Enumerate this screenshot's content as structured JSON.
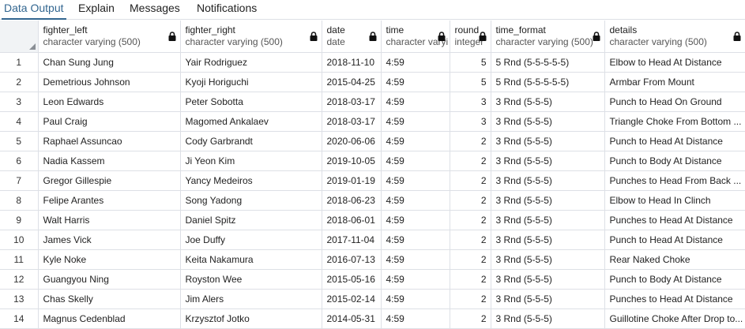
{
  "tabs": [
    {
      "label": "Data Output"
    },
    {
      "label": "Explain"
    },
    {
      "label": "Messages"
    },
    {
      "label": "Notifications"
    }
  ],
  "columns": [
    {
      "name": "fighter_left",
      "type": "character varying (500)"
    },
    {
      "name": "fighter_right",
      "type": "character varying (500)"
    },
    {
      "name": "date",
      "type": "date"
    },
    {
      "name": "time",
      "type": "character varyi"
    },
    {
      "name": "round",
      "type": "integer"
    },
    {
      "name": "time_format",
      "type": "character varying (500)"
    },
    {
      "name": "details",
      "type": "character varying (500)"
    }
  ],
  "rows": [
    [
      "1",
      "Chan Sung Jung",
      "Yair Rodriguez",
      "2018-11-10",
      "4:59",
      "5",
      "5 Rnd (5-5-5-5-5)",
      "Elbow to Head At Distance"
    ],
    [
      "2",
      "Demetrious Johnson",
      "Kyoji Horiguchi",
      "2015-04-25",
      "4:59",
      "5",
      "5 Rnd (5-5-5-5-5)",
      "Armbar From Mount"
    ],
    [
      "3",
      "Leon Edwards",
      "Peter Sobotta",
      "2018-03-17",
      "4:59",
      "3",
      "3 Rnd (5-5-5)",
      "Punch to Head On Ground"
    ],
    [
      "4",
      "Paul Craig",
      "Magomed Ankalaev",
      "2018-03-17",
      "4:59",
      "3",
      "3 Rnd (5-5-5)",
      "Triangle Choke From Bottom ..."
    ],
    [
      "5",
      "Raphael Assuncao",
      "Cody Garbrandt",
      "2020-06-06",
      "4:59",
      "2",
      "3 Rnd (5-5-5)",
      "Punch to Head At Distance"
    ],
    [
      "6",
      "Nadia Kassem",
      "Ji Yeon Kim",
      "2019-10-05",
      "4:59",
      "2",
      "3 Rnd (5-5-5)",
      "Punch to Body At Distance"
    ],
    [
      "7",
      "Gregor Gillespie",
      "Yancy Medeiros",
      "2019-01-19",
      "4:59",
      "2",
      "3 Rnd (5-5-5)",
      "Punches to Head From Back ..."
    ],
    [
      "8",
      "Felipe Arantes",
      "Song Yadong",
      "2018-06-23",
      "4:59",
      "2",
      "3 Rnd (5-5-5)",
      "Elbow to Head In Clinch"
    ],
    [
      "9",
      "Walt Harris",
      "Daniel Spitz",
      "2018-06-01",
      "4:59",
      "2",
      "3 Rnd (5-5-5)",
      "Punches to Head At Distance"
    ],
    [
      "10",
      "James Vick",
      "Joe Duffy",
      "2017-11-04",
      "4:59",
      "2",
      "3 Rnd (5-5-5)",
      "Punch to Head At Distance"
    ],
    [
      "11",
      "Kyle Noke",
      "Keita Nakamura",
      "2016-07-13",
      "4:59",
      "2",
      "3 Rnd (5-5-5)",
      "Rear Naked Choke"
    ],
    [
      "12",
      "Guangyou Ning",
      "Royston Wee",
      "2015-05-16",
      "4:59",
      "2",
      "3 Rnd (5-5-5)",
      "Punch to Body At Distance"
    ],
    [
      "13",
      "Chas Skelly",
      "Jim Alers",
      "2015-02-14",
      "4:59",
      "2",
      "3 Rnd (5-5-5)",
      "Punches to Head At Distance"
    ],
    [
      "14",
      "Magnus Cedenblad",
      "Krzysztof Jotko",
      "2014-05-31",
      "4:59",
      "2",
      "3 Rnd (5-5-5)",
      "Guillotine Choke After Drop to..."
    ]
  ]
}
